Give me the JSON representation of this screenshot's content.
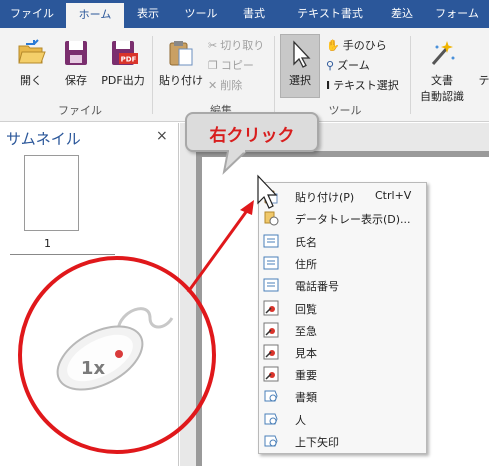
{
  "tabs": [
    "ファイル",
    "ホーム",
    "表示",
    "ツール",
    "書式",
    "テキスト書式",
    "差込",
    "フォーム"
  ],
  "ribbon": {
    "file_group": {
      "open": "開く",
      "save": "保存",
      "pdf": "PDF出力",
      "pdf_badge": "PDF",
      "label": "ファイル"
    },
    "edit_group": {
      "paste": "貼り付け",
      "cut": "切り取り",
      "copy": "コピー",
      "delete": "削除",
      "label": "編集"
    },
    "tool_group": {
      "select": "選択",
      "hand": "手のひら",
      "zoom": "ズーム",
      "text_select": "テキスト選択",
      "label": "ツール"
    },
    "doc_group": {
      "auto_recognize_line1": "文書",
      "auto_recognize_line2": "自動認識",
      "cut_off": "テ"
    }
  },
  "thumbnail_pane": {
    "title": "サムネイル",
    "close": "×",
    "page_number": "1"
  },
  "callout": "右クリック",
  "mouse_badge": "1x",
  "context_menu": [
    {
      "label": "貼り付け(P)",
      "shortcut": "Ctrl+V",
      "icon": "paste-icon"
    },
    {
      "label": "データトレー表示(D)...",
      "shortcut": "",
      "icon": "data-tray-icon"
    },
    {
      "label": "氏名",
      "shortcut": "",
      "icon": "text-field-icon"
    },
    {
      "label": "住所",
      "shortcut": "",
      "icon": "text-field-icon"
    },
    {
      "label": "電話番号",
      "shortcut": "",
      "icon": "text-field-icon"
    },
    {
      "label": "回覧",
      "shortcut": "",
      "icon": "stamp-icon"
    },
    {
      "label": "至急",
      "shortcut": "",
      "icon": "stamp-icon"
    },
    {
      "label": "見本",
      "shortcut": "",
      "icon": "stamp-icon"
    },
    {
      "label": "重要",
      "shortcut": "",
      "icon": "stamp-icon"
    },
    {
      "label": "書類",
      "shortcut": "",
      "icon": "shape-icon"
    },
    {
      "label": "人",
      "shortcut": "",
      "icon": "shape-icon"
    },
    {
      "label": "上下矢印",
      "shortcut": "",
      "icon": "shape-icon"
    }
  ],
  "colors": {
    "tab_bar": "#2b579a",
    "ribbon_bg": "#f3f3f3",
    "annotation_red": "#e0181b",
    "callout_text": "#d81e1e"
  }
}
